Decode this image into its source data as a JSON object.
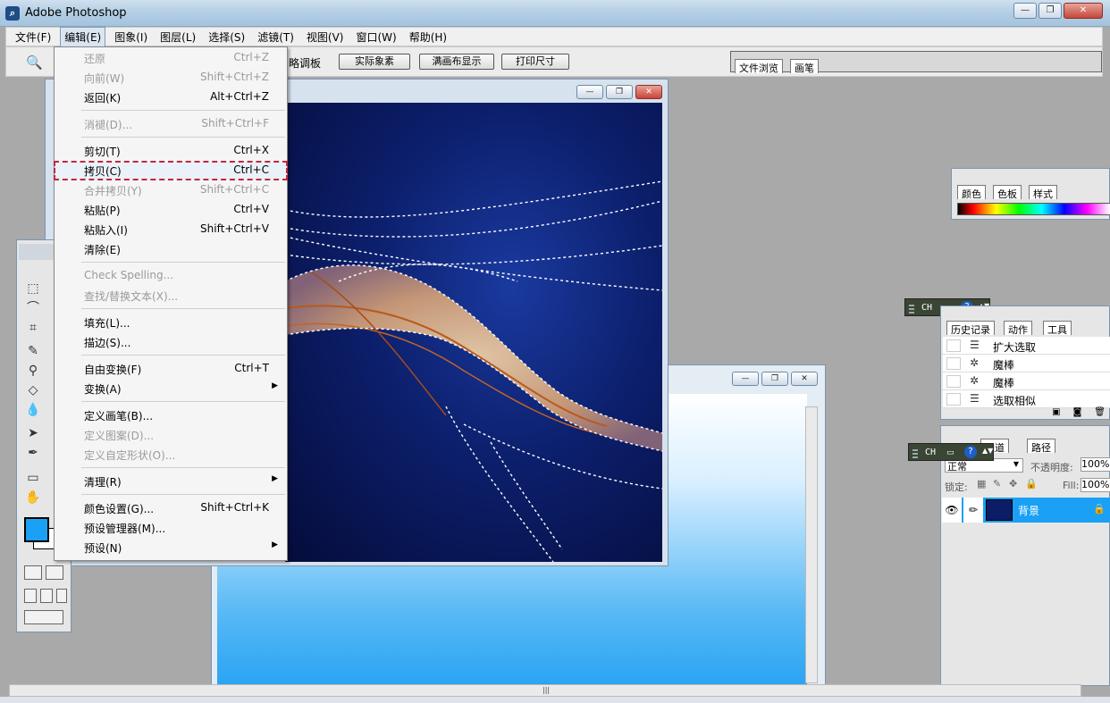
{
  "window": {
    "title": "Adobe Photoshop",
    "app_icon_glyph": "⌕"
  },
  "menubar": [
    "文件(F)",
    "编辑(E)",
    "图象(I)",
    "图层(L)",
    "选择(S)",
    "滤镜(T)",
    "视图(V)",
    "窗口(W)",
    "帮助(H)"
  ],
  "options": {
    "partial_label": "略调板",
    "buttons": [
      "实际象素",
      "满画布显示",
      "打印尺寸"
    ],
    "palette_well_tabs": [
      "文件浏览",
      "画笔"
    ]
  },
  "edit_menu": {
    "items": [
      {
        "label": "还原",
        "shortcut": "Ctrl+Z",
        "disabled": true
      },
      {
        "label": "向前(W)",
        "shortcut": "Shift+Ctrl+Z",
        "disabled": true
      },
      {
        "label": "返回(K)",
        "shortcut": "Alt+Ctrl+Z",
        "disabled": false
      },
      {
        "label": "消褪(D)...",
        "shortcut": "Shift+Ctrl+F",
        "disabled": true
      },
      {
        "label": "剪切(T)",
        "shortcut": "Ctrl+X",
        "disabled": false
      },
      {
        "label": "拷贝(C)",
        "shortcut": "Ctrl+C",
        "disabled": false
      },
      {
        "label": "合并拷贝(Y)",
        "shortcut": "Shift+Ctrl+C",
        "disabled": true
      },
      {
        "label": "粘贴(P)",
        "shortcut": "Ctrl+V",
        "disabled": false
      },
      {
        "label": "粘贴入(I)",
        "shortcut": "Shift+Ctrl+V",
        "disabled": false
      },
      {
        "label": "清除(E)",
        "shortcut": "",
        "disabled": false
      },
      {
        "label": "Check Spelling...",
        "shortcut": "",
        "disabled": true
      },
      {
        "label": "查找/替换文本(X)...",
        "shortcut": "",
        "disabled": true
      },
      {
        "label": "填充(L)...",
        "shortcut": "",
        "disabled": false
      },
      {
        "label": "描边(S)...",
        "shortcut": "",
        "disabled": false
      },
      {
        "label": "自由变换(F)",
        "shortcut": "Ctrl+T",
        "disabled": false
      },
      {
        "label": "变换(A)",
        "shortcut": "",
        "disabled": false
      },
      {
        "label": "定义画笔(B)...",
        "shortcut": "",
        "disabled": false
      },
      {
        "label": "定义图案(D)...",
        "shortcut": "",
        "disabled": true
      },
      {
        "label": "定义自定形状(O)...",
        "shortcut": "",
        "disabled": true
      },
      {
        "label": "清理(R)",
        "shortcut": "",
        "disabled": false
      },
      {
        "label": "颜色设置(G)...",
        "shortcut": "Shift+Ctrl+K",
        "disabled": false
      },
      {
        "label": "预设管理器(M)...",
        "shortcut": "",
        "disabled": false
      },
      {
        "label": "预设(N)",
        "shortcut": "",
        "disabled": false
      }
    ],
    "highlighted": "拷贝(C)"
  },
  "color_panel": {
    "tabs": [
      "颜色",
      "色板",
      "样式"
    ]
  },
  "lang_bar": {
    "code": "CH"
  },
  "history_panel": {
    "tabs": [
      "历史记录",
      "动作",
      "工具"
    ],
    "rows": [
      "扩大选取",
      "魔棒",
      "魔棒",
      "选取相似"
    ]
  },
  "layers_panel": {
    "tabs": [
      "通道",
      "路径"
    ],
    "blend_mode": "正常",
    "opacity_label": "不透明度:",
    "opacity_value": "100%",
    "lock_label": "锁定:",
    "fill_label": "Fill:",
    "fill_value": "100%",
    "layer_name": "背景"
  },
  "colors": {
    "accent": "#1aa0f4",
    "highlight_border": "#c0283a"
  }
}
